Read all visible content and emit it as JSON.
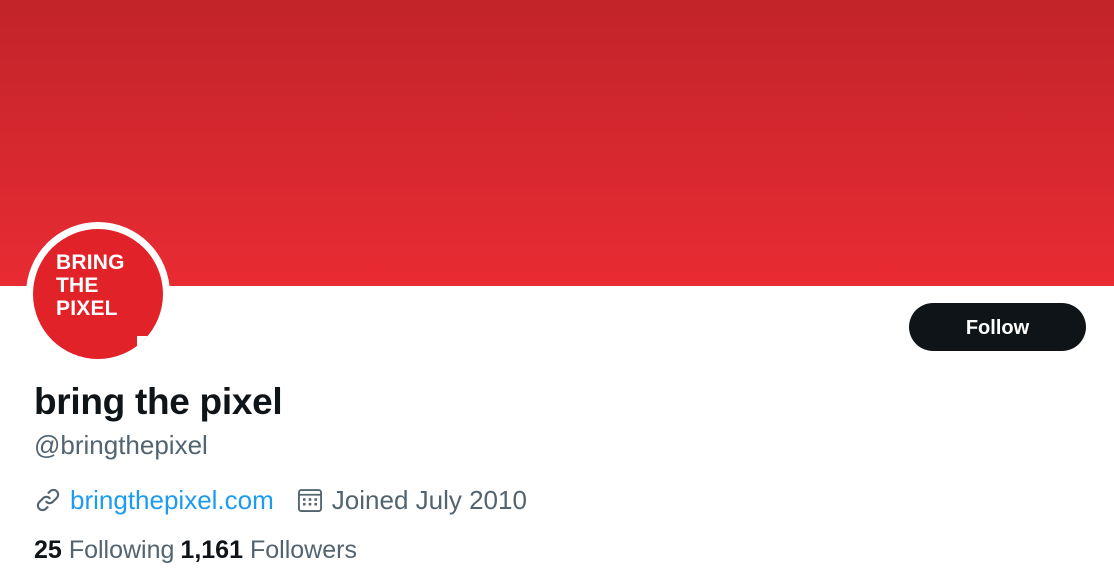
{
  "profile": {
    "display_name": "bring the pixel",
    "handle": "@bringthepixel",
    "website": "bringthepixel.com",
    "joined": "Joined July 2010",
    "follow_label": "Follow",
    "avatar_logo": [
      "BRING",
      "THE",
      "PIXEL"
    ],
    "stats": {
      "following_count": "25",
      "following_label": "Following",
      "followers_count": "1,161",
      "followers_label": "Followers"
    }
  },
  "icons": {
    "website": "link-icon",
    "joined": "calendar-icon"
  },
  "colors": {
    "banner_top": "#c1242a",
    "banner_bottom": "#e92b33",
    "avatar": "#e12229",
    "follow_button": "#0f1419",
    "link": "#1d9bf0",
    "secondary_text": "#536471",
    "primary_text": "#0f1419"
  }
}
